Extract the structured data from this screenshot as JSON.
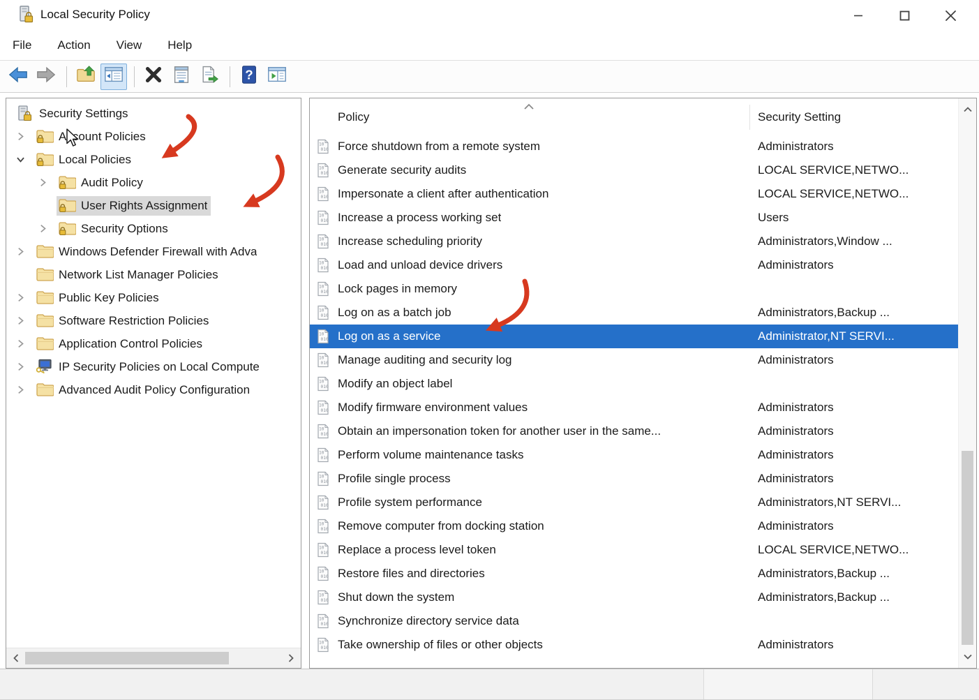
{
  "window": {
    "title": "Local Security Policy",
    "controls": [
      {
        "name": "minimize-button",
        "icon": "minimize-icon"
      },
      {
        "name": "maximize-button",
        "icon": "maximize-icon"
      },
      {
        "name": "close-button",
        "icon": "close-icon"
      }
    ]
  },
  "menu": {
    "items": [
      {
        "label": "File"
      },
      {
        "label": "Action"
      },
      {
        "label": "View"
      },
      {
        "label": "Help"
      }
    ]
  },
  "toolbar": {
    "buttons": [
      {
        "name": "back-button",
        "icon": "back-icon"
      },
      {
        "name": "forward-button",
        "icon": "forward-icon"
      },
      {
        "separator": true
      },
      {
        "name": "up-one-level-button",
        "icon": "up-one-level-icon"
      },
      {
        "name": "show-console-tree-button",
        "icon": "show-console-tree-icon",
        "state": "active"
      },
      {
        "separator": true
      },
      {
        "name": "delete-button",
        "icon": "delete-icon"
      },
      {
        "name": "properties-button",
        "icon": "properties-icon"
      },
      {
        "name": "export-list-button",
        "icon": "export-list-icon"
      },
      {
        "separator": true
      },
      {
        "name": "help-button",
        "icon": "help-icon"
      },
      {
        "name": "show-action-pane-button",
        "icon": "show-action-pane-icon"
      }
    ]
  },
  "tree": {
    "items": [
      {
        "label": "Security Settings",
        "level": 0,
        "expander": "none",
        "icon": "security-root-icon",
        "selected": false
      },
      {
        "label": "Account Policies",
        "level": 1,
        "expander": "collapsed",
        "icon": "folder-lock-icon",
        "selected": false
      },
      {
        "label": "Local Policies",
        "level": 1,
        "expander": "expanded",
        "icon": "folder-lock-icon",
        "selected": false
      },
      {
        "label": "Audit Policy",
        "level": 2,
        "expander": "collapsed",
        "icon": "folder-lock-icon",
        "selected": false
      },
      {
        "label": "User Rights Assignment",
        "level": 2,
        "expander": "none",
        "icon": "folder-lock-icon",
        "selected": true
      },
      {
        "label": "Security Options",
        "level": 2,
        "expander": "collapsed",
        "icon": "folder-lock-icon",
        "selected": false
      },
      {
        "label": "Windows Defender Firewall with Adva",
        "level": 1,
        "expander": "collapsed",
        "icon": "folder-icon",
        "selected": false
      },
      {
        "label": "Network List Manager Policies",
        "level": 1,
        "expander": "none",
        "icon": "folder-icon",
        "selected": false
      },
      {
        "label": "Public Key Policies",
        "level": 1,
        "expander": "collapsed",
        "icon": "folder-icon",
        "selected": false
      },
      {
        "label": "Software Restriction Policies",
        "level": 1,
        "expander": "collapsed",
        "icon": "folder-icon",
        "selected": false
      },
      {
        "label": "Application Control Policies",
        "level": 1,
        "expander": "collapsed",
        "icon": "folder-icon",
        "selected": false
      },
      {
        "label": "IP Security Policies on Local Compute",
        "level": 1,
        "expander": "collapsed",
        "icon": "ipsec-icon",
        "selected": false
      },
      {
        "label": "Advanced Audit Policy Configuration",
        "level": 1,
        "expander": "collapsed",
        "icon": "folder-icon",
        "selected": false
      }
    ]
  },
  "list": {
    "columns": [
      "Policy",
      "Security Setting"
    ],
    "sort": {
      "column": "Policy",
      "direction": "ascending"
    },
    "rows": [
      {
        "policy": "Force shutdown from a remote system",
        "setting": "Administrators",
        "selected": false
      },
      {
        "policy": "Generate security audits",
        "setting": "LOCAL SERVICE,NETWO...",
        "selected": false
      },
      {
        "policy": "Impersonate a client after authentication",
        "setting": "LOCAL SERVICE,NETWO...",
        "selected": false
      },
      {
        "policy": "Increase a process working set",
        "setting": "Users",
        "selected": false
      },
      {
        "policy": "Increase scheduling priority",
        "setting": "Administrators,Window ...",
        "selected": false
      },
      {
        "policy": "Load and unload device drivers",
        "setting": "Administrators",
        "selected": false
      },
      {
        "policy": "Lock pages in memory",
        "setting": "",
        "selected": false
      },
      {
        "policy": "Log on as a batch job",
        "setting": "Administrators,Backup ...",
        "selected": false
      },
      {
        "policy": "Log on as a service",
        "setting": "Administrator,NT SERVI...",
        "selected": true
      },
      {
        "policy": "Manage auditing and security log",
        "setting": "Administrators",
        "selected": false
      },
      {
        "policy": "Modify an object label",
        "setting": "",
        "selected": false
      },
      {
        "policy": "Modify firmware environment values",
        "setting": "Administrators",
        "selected": false
      },
      {
        "policy": "Obtain an impersonation token for another user in the same...",
        "setting": "Administrators",
        "selected": false
      },
      {
        "policy": "Perform volume maintenance tasks",
        "setting": "Administrators",
        "selected": false
      },
      {
        "policy": "Profile single process",
        "setting": "Administrators",
        "selected": false
      },
      {
        "policy": "Profile system performance",
        "setting": "Administrators,NT SERVI...",
        "selected": false
      },
      {
        "policy": "Remove computer from docking station",
        "setting": "Administrators",
        "selected": false
      },
      {
        "policy": "Replace a process level token",
        "setting": "LOCAL SERVICE,NETWO...",
        "selected": false
      },
      {
        "policy": "Restore files and directories",
        "setting": "Administrators,Backup ...",
        "selected": false
      },
      {
        "policy": "Shut down the system",
        "setting": "Administrators,Backup ...",
        "selected": false
      },
      {
        "policy": "Synchronize directory service data",
        "setting": "",
        "selected": false
      },
      {
        "policy": "Take ownership of files or other objects",
        "setting": "Administrators",
        "selected": false
      }
    ]
  },
  "annotations": {
    "arrows": [
      {
        "target": "Local Policies"
      },
      {
        "target": "User Rights Assignment"
      },
      {
        "target": "Log on as a service"
      }
    ]
  },
  "colors": {
    "accent": "#2570c9",
    "tree_selection": "#d9d9d9",
    "annotation": "#d7391f",
    "folder_yellow": "#f5e1a4",
    "statusbar_bg": "#f1f1f1"
  }
}
